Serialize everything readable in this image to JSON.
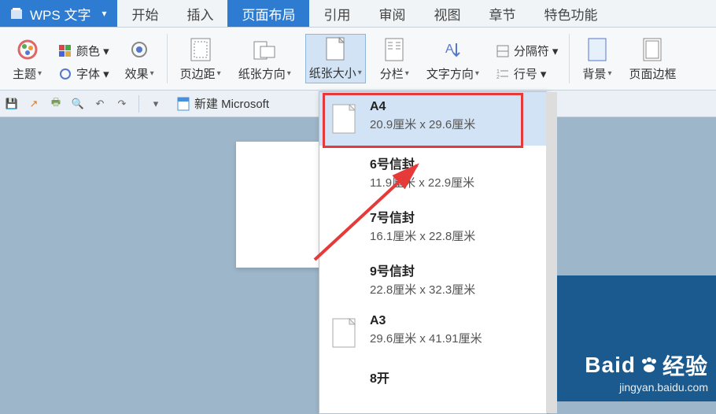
{
  "app": {
    "name": "WPS 文字"
  },
  "tabs": {
    "items": [
      {
        "label": "开始"
      },
      {
        "label": "插入"
      },
      {
        "label": "页面布局",
        "active": true
      },
      {
        "label": "引用"
      },
      {
        "label": "审阅"
      },
      {
        "label": "视图"
      },
      {
        "label": "章节"
      },
      {
        "label": "特色功能"
      }
    ]
  },
  "ribbon": {
    "theme_label": "主题",
    "color_label": "颜色",
    "font_label": "字体",
    "effect_label": "效果",
    "margin_label": "页边距",
    "orientation_label": "纸张方向",
    "size_label": "纸张大小",
    "columns_label": "分栏",
    "textdir_label": "文字方向",
    "breaks_label": "分隔符",
    "linenum_label": "行号",
    "background_label": "背景",
    "pageborder_label": "页面边框"
  },
  "qat": {
    "doc_label": "新建 Microsoft"
  },
  "paper_sizes": {
    "items": [
      {
        "name": "A4",
        "size": "20.9厘米 x 29.6厘米",
        "selected": true,
        "icon": true
      },
      {
        "name": "6号信封",
        "size": "11.9厘米 x 22.9厘米"
      },
      {
        "name": "7号信封",
        "size": "16.1厘米 x 22.8厘米"
      },
      {
        "name": "9号信封",
        "size": "22.8厘米 x 32.3厘米"
      },
      {
        "name": "A3",
        "size": "29.6厘米 x 41.91厘米",
        "icon": true
      },
      {
        "name": "8开",
        "size": ""
      }
    ]
  },
  "watermark": {
    "main": "Baid",
    "suffix": "经验",
    "sub": "jingyan.baidu.com"
  }
}
